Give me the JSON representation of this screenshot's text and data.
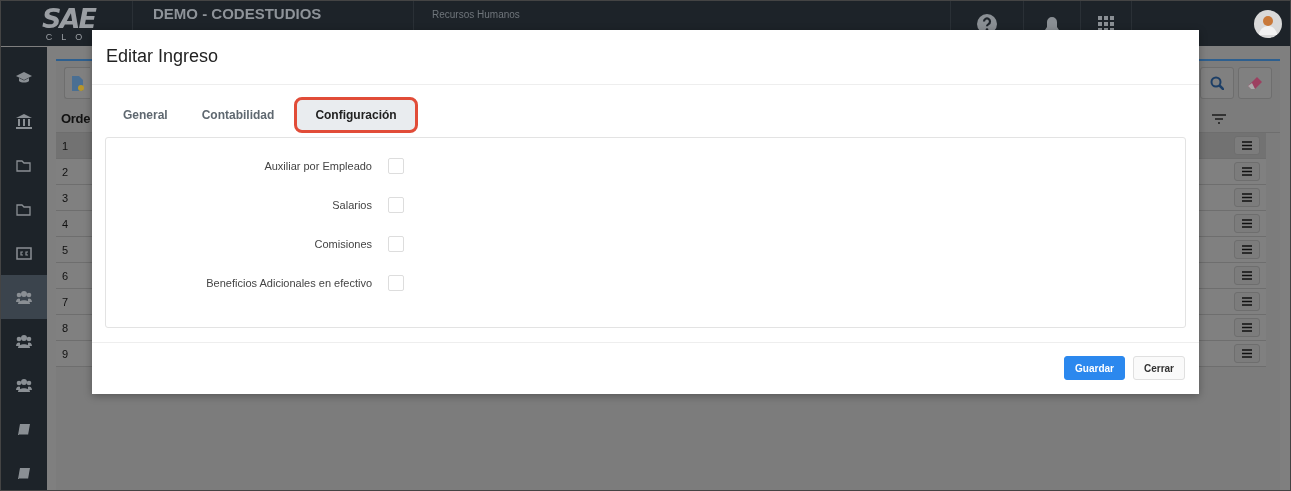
{
  "top_bar": {
    "logo": "SAE",
    "logo_sub": "CLO",
    "company": "DEMO - CODESTUDIOS",
    "module": "Recursos Humanos"
  },
  "sidebar": {
    "items": [
      {
        "kind": "cap",
        "selected": false
      },
      {
        "kind": "bank",
        "selected": false
      },
      {
        "kind": "folder",
        "selected": false
      },
      {
        "kind": "folder",
        "selected": false
      },
      {
        "kind": "cc",
        "selected": false
      },
      {
        "kind": "users",
        "selected": true
      },
      {
        "kind": "users",
        "selected": false
      },
      {
        "kind": "users",
        "selected": false
      },
      {
        "kind": "book",
        "selected": false
      },
      {
        "kind": "book",
        "selected": false
      }
    ]
  },
  "table": {
    "columns": [
      "Orde"
    ],
    "rows": [
      {
        "column_1": "1",
        "selected": true
      },
      {
        "column_1": "2",
        "selected": false
      },
      {
        "column_1": "3",
        "selected": false
      },
      {
        "column_1": "4",
        "selected": false
      },
      {
        "column_1": "5",
        "selected": false
      },
      {
        "column_1": "6",
        "selected": false
      },
      {
        "column_1": "7",
        "selected": false
      },
      {
        "column_1": "8",
        "selected": false
      },
      {
        "column_1": "9",
        "selected": false
      }
    ]
  },
  "modal": {
    "title": "Editar Ingreso",
    "tabs": [
      {
        "label": "General",
        "selected": false
      },
      {
        "label": "Contabilidad",
        "selected": false
      },
      {
        "label": "Configuración",
        "selected": true
      }
    ],
    "fields": [
      {
        "label": "Auxiliar por Empleado",
        "checked": false
      },
      {
        "label": "Salarios",
        "checked": false
      },
      {
        "label": "Comisiones",
        "checked": false
      },
      {
        "label": "Beneficios Adicionales en efectivo",
        "checked": false
      }
    ],
    "buttons": [
      {
        "label": "Guardar",
        "kind": "primary"
      },
      {
        "label": "Cerrar",
        "kind": "default"
      }
    ]
  }
}
